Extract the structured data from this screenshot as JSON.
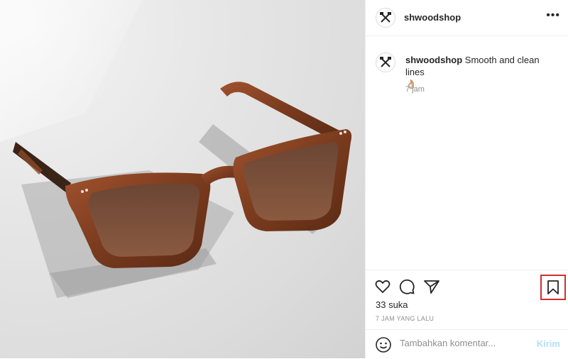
{
  "post": {
    "username": "shwoodshop",
    "caption_user": "shwoodshop",
    "caption_text": "Smooth and clean lines",
    "caption_emoji": "👌🏼",
    "caption_time": "7 jam",
    "likes": "33 suka",
    "time_ago": "7 JAM YANG LALU"
  },
  "comment": {
    "placeholder": "Tambahkan komentar...",
    "send_label": "Kirim"
  },
  "icons": {
    "more": "more-options-icon",
    "like": "heart-icon",
    "comment": "comment-icon",
    "share": "paper-plane-icon",
    "save": "bookmark-icon",
    "emoji": "emoji-icon",
    "avatar": "axes-logo"
  },
  "colors": {
    "highlight": "#d32f2f",
    "send_disabled": "#b2dffc"
  }
}
